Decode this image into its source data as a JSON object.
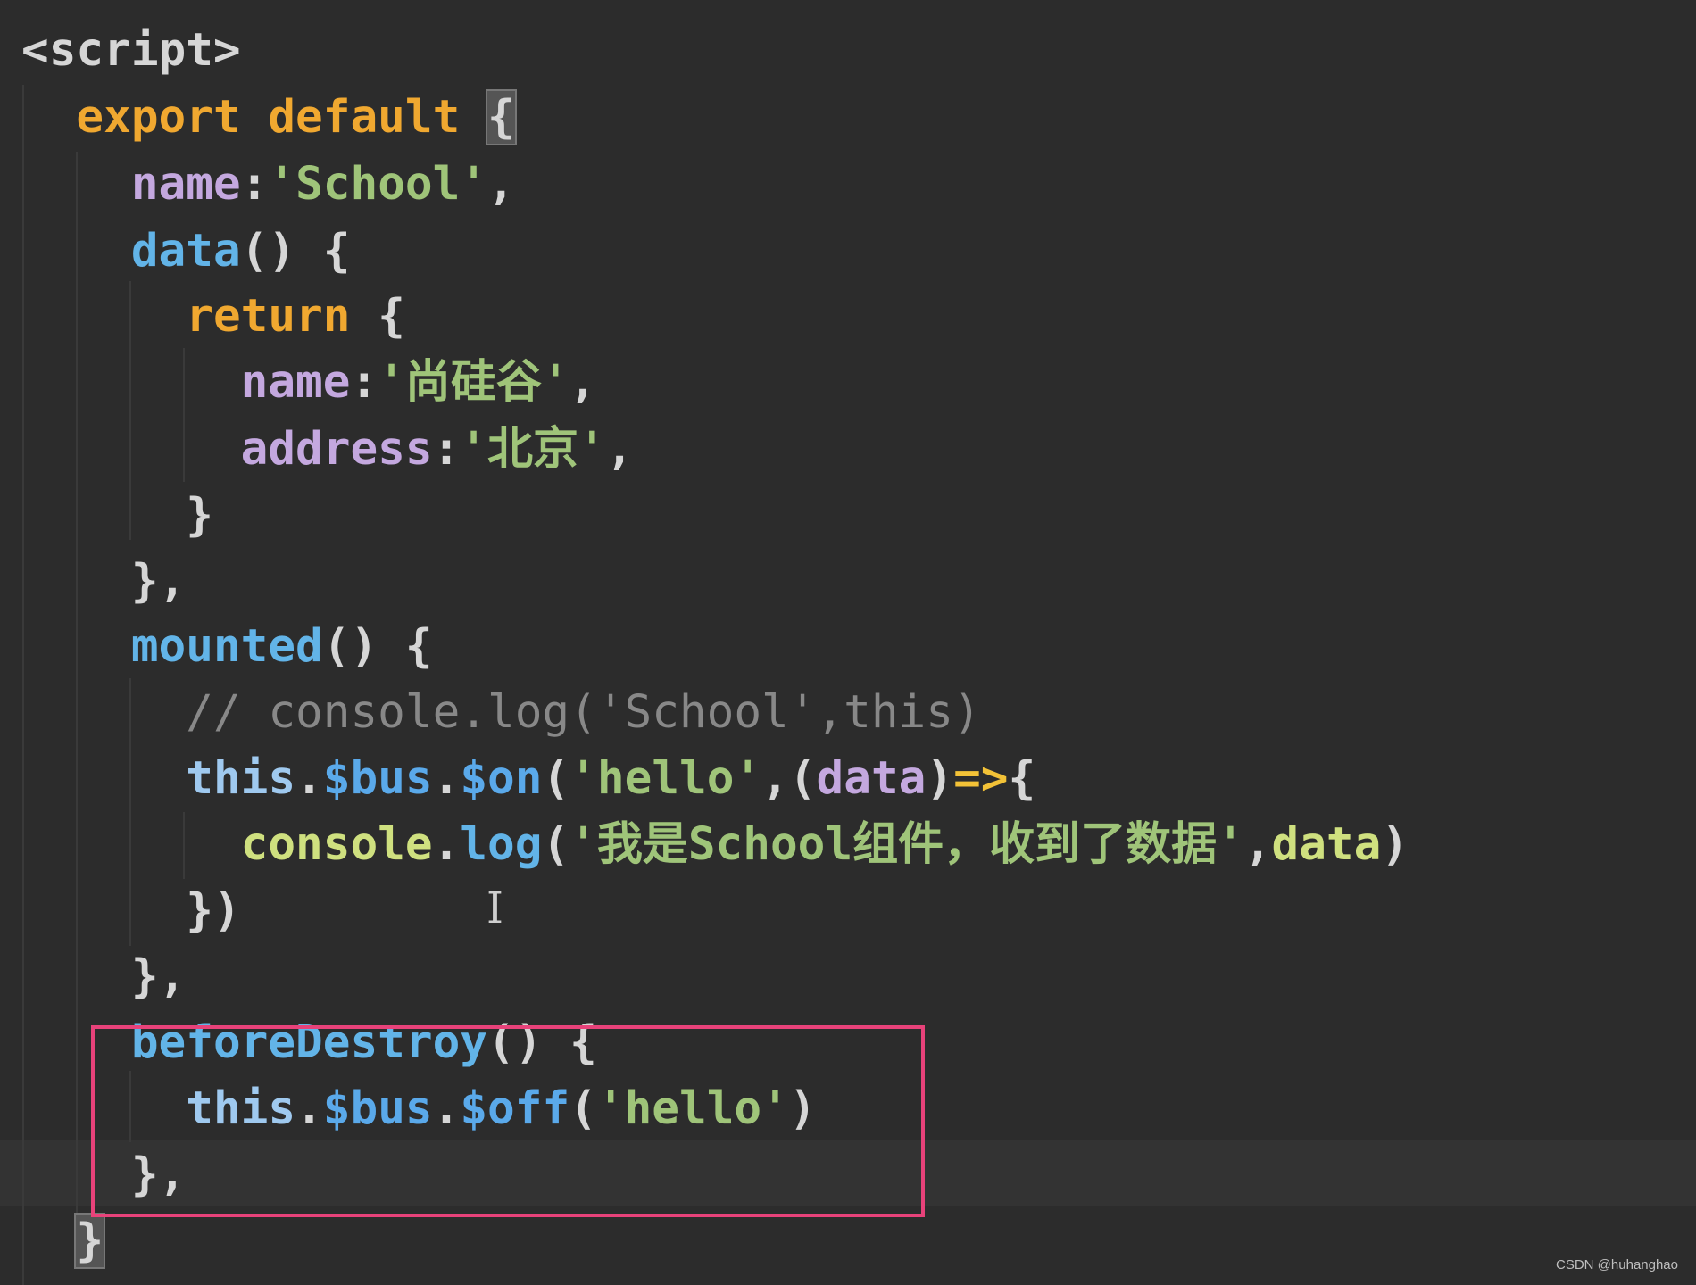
{
  "watermark": "CSDN @huhanghao",
  "cursor_glyph": "I",
  "colors": {
    "background": "#2c2c2c",
    "keyword": "#f0a830",
    "property": "#c4a8df",
    "string": "#9fc479",
    "function": "#62b4e8",
    "comment": "#888888",
    "highlight_box": "#e8427a"
  },
  "code_lines": [
    {
      "tokens": [
        {
          "t": "<script>",
          "c": "tag"
        }
      ]
    },
    {
      "tokens": [
        {
          "t": "  "
        },
        {
          "t": "export default",
          "c": "kw"
        },
        {
          "t": " "
        },
        {
          "t": "{",
          "c": "punc",
          "m": true
        }
      ]
    },
    {
      "tokens": [
        {
          "t": "    "
        },
        {
          "t": "name",
          "c": "prop"
        },
        {
          "t": ":",
          "c": "punc"
        },
        {
          "t": "'School'",
          "c": "str"
        },
        {
          "t": ",",
          "c": "punc"
        }
      ]
    },
    {
      "tokens": [
        {
          "t": "    "
        },
        {
          "t": "data",
          "c": "fn"
        },
        {
          "t": "() {",
          "c": "punc"
        }
      ]
    },
    {
      "tokens": [
        {
          "t": "      "
        },
        {
          "t": "return",
          "c": "kw"
        },
        {
          "t": " {",
          "c": "punc"
        }
      ]
    },
    {
      "tokens": [
        {
          "t": "        "
        },
        {
          "t": "name",
          "c": "prop"
        },
        {
          "t": ":",
          "c": "punc"
        },
        {
          "t": "'尚硅谷'",
          "c": "str"
        },
        {
          "t": ",",
          "c": "punc"
        }
      ]
    },
    {
      "tokens": [
        {
          "t": "        "
        },
        {
          "t": "address",
          "c": "prop"
        },
        {
          "t": ":",
          "c": "punc"
        },
        {
          "t": "'北京'",
          "c": "str"
        },
        {
          "t": ",",
          "c": "punc"
        }
      ]
    },
    {
      "tokens": [
        {
          "t": "      "
        },
        {
          "t": "}",
          "c": "punc"
        }
      ]
    },
    {
      "tokens": [
        {
          "t": "    "
        },
        {
          "t": "},",
          "c": "punc"
        }
      ]
    },
    {
      "tokens": [
        {
          "t": "    "
        },
        {
          "t": "mounted",
          "c": "fn"
        },
        {
          "t": "() {",
          "c": "punc"
        }
      ]
    },
    {
      "tokens": [
        {
          "t": "      "
        },
        {
          "t": "// console.log('School',this)",
          "c": "comment"
        }
      ]
    },
    {
      "tokens": [
        {
          "t": "      "
        },
        {
          "t": "this",
          "c": "this"
        },
        {
          "t": ".",
          "c": "punc"
        },
        {
          "t": "$bus",
          "c": "var"
        },
        {
          "t": ".",
          "c": "punc"
        },
        {
          "t": "$on",
          "c": "var"
        },
        {
          "t": "(",
          "c": "punc"
        },
        {
          "t": "'hello'",
          "c": "str"
        },
        {
          "t": ",(",
          "c": "punc"
        },
        {
          "t": "data",
          "c": "param"
        },
        {
          "t": ")",
          "c": "punc"
        },
        {
          "t": "=>",
          "c": "arrow"
        },
        {
          "t": "{",
          "c": "punc"
        }
      ]
    },
    {
      "tokens": [
        {
          "t": "        "
        },
        {
          "t": "console",
          "c": "console"
        },
        {
          "t": ".",
          "c": "punc"
        },
        {
          "t": "log",
          "c": "fn"
        },
        {
          "t": "(",
          "c": "punc"
        },
        {
          "t": "'我是School组件，收到了数据'",
          "c": "str"
        },
        {
          "t": ",",
          "c": "punc"
        },
        {
          "t": "data",
          "c": "console"
        },
        {
          "t": ")",
          "c": "punc"
        }
      ]
    },
    {
      "tokens": [
        {
          "t": "      "
        },
        {
          "t": "})",
          "c": "punc"
        }
      ]
    },
    {
      "tokens": [
        {
          "t": "    "
        },
        {
          "t": "},",
          "c": "punc"
        }
      ]
    },
    {
      "tokens": [
        {
          "t": "    "
        },
        {
          "t": "beforeDestroy",
          "c": "fn"
        },
        {
          "t": "() {",
          "c": "punc"
        }
      ]
    },
    {
      "tokens": [
        {
          "t": "      "
        },
        {
          "t": "this",
          "c": "this"
        },
        {
          "t": ".",
          "c": "punc"
        },
        {
          "t": "$bus",
          "c": "var"
        },
        {
          "t": ".",
          "c": "punc"
        },
        {
          "t": "$off",
          "c": "var"
        },
        {
          "t": "(",
          "c": "punc"
        },
        {
          "t": "'hello'",
          "c": "str"
        },
        {
          "t": ")",
          "c": "punc"
        }
      ]
    },
    {
      "tokens": [
        {
          "t": "    "
        },
        {
          "t": "},",
          "c": "punc"
        }
      ]
    },
    {
      "tokens": [
        {
          "t": "  "
        },
        {
          "t": "}",
          "c": "punc",
          "m": true
        }
      ]
    }
  ]
}
